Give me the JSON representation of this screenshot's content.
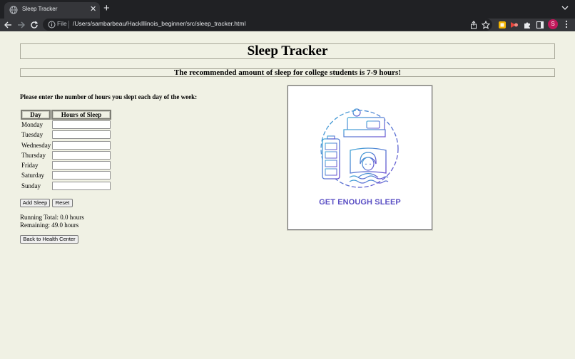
{
  "browser": {
    "tab_title": "Sleep Tracker",
    "url_scheme": "File",
    "url": "/Users/sambarbeau/HackIllinois_beginner/src/sleep_tracker.html",
    "avatar_letter": "S"
  },
  "page": {
    "title": "Sleep Tracker",
    "subtitle": "The recommended amount of sleep for college students is 7-9 hours!",
    "instructions": "Please enter the number of hours you slept each day of the week:",
    "table_headers": {
      "day": "Day",
      "hours": "Hours of Sleep"
    },
    "days": [
      "Monday",
      "Tuesday",
      "Wednesday",
      "Thursday",
      "Friday",
      "Saturday",
      "Sunday"
    ],
    "hours_values": [
      "",
      "",
      "",
      "",
      "",
      "",
      ""
    ],
    "buttons": {
      "add": "Add Sleep",
      "reset": "Reset",
      "back": "Back to Health Center"
    },
    "running_total": "Running Total: 0.0 hours",
    "remaining": "Remaining: 49.0 hours",
    "illustration_caption": "GET ENOUGH SLEEP"
  },
  "colors": {
    "page_bg": "#f0f1e4",
    "caption": "#5a4fc4"
  }
}
